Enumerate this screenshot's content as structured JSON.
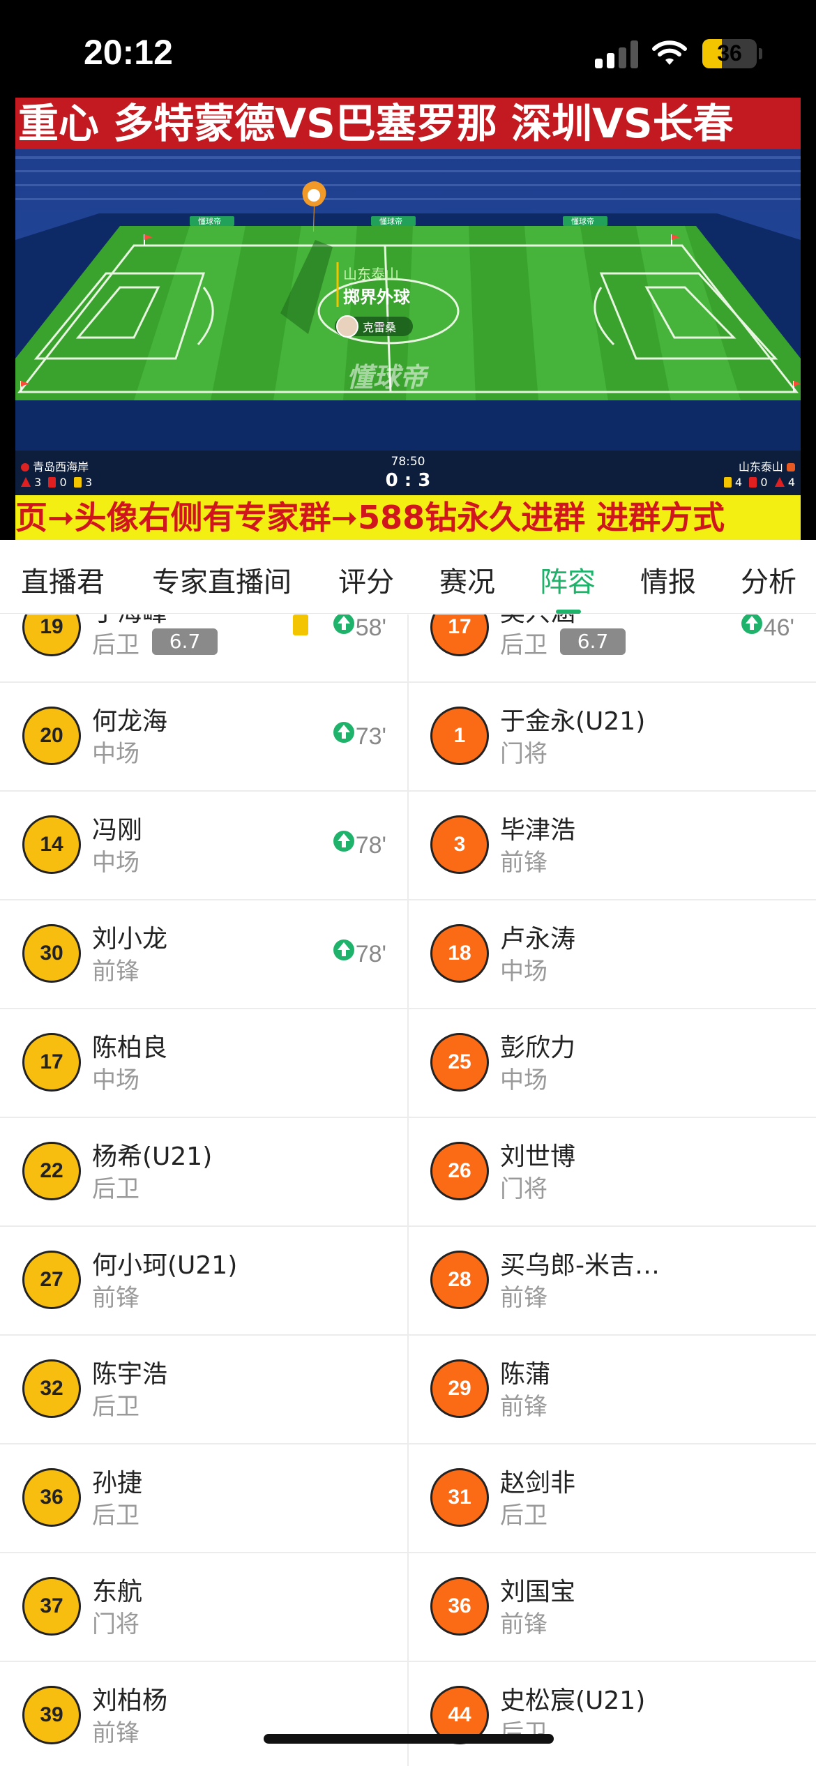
{
  "status_bar": {
    "time": "20:12",
    "battery": "36",
    "battery_level": 0.36
  },
  "video": {
    "ticker": "重心  多特蒙德VS巴塞罗那  深圳VS长春",
    "watermark": "懂球帝",
    "ad_board": "懂球帝",
    "event_team": "山东泰山",
    "event": "掷界外球",
    "event_player": "克雷桑",
    "home_team": "青岛西海岸",
    "away_team": "山东泰山",
    "clock": "78:50",
    "score_home": "0",
    "score_away": "3",
    "home_counts": {
      "corners": "3",
      "red": "0",
      "yellow": "3"
    },
    "away_counts": {
      "yellow": "4",
      "red": "0",
      "corners": "4"
    },
    "banner": "页➞头像右侧有专家群➞588钻永久进群    进群方式"
  },
  "tabs": [
    "直播君",
    "专家直播间",
    "评分",
    "赛况",
    "阵容",
    "情报",
    "分析"
  ],
  "active_tab": "阵容",
  "home_players": [
    {
      "number": "19",
      "name": "丁海峰",
      "position": "后卫",
      "rating": "6.7",
      "sub_minute": "58'",
      "yellow_card": true
    },
    {
      "number": "20",
      "name": "何龙海",
      "position": "中场",
      "sub_minute": "73'"
    },
    {
      "number": "14",
      "name": "冯刚",
      "position": "中场",
      "sub_minute": "78'"
    },
    {
      "number": "30",
      "name": "刘小龙",
      "position": "前锋",
      "sub_minute": "78'"
    },
    {
      "number": "17",
      "name": "陈柏良",
      "position": "中场"
    },
    {
      "number": "22",
      "name": "杨希(U21)",
      "position": "后卫"
    },
    {
      "number": "27",
      "name": "何小珂(U21)",
      "position": "前锋"
    },
    {
      "number": "32",
      "name": "陈宇浩",
      "position": "后卫"
    },
    {
      "number": "36",
      "name": "孙捷",
      "position": "后卫"
    },
    {
      "number": "37",
      "name": "东航",
      "position": "门将"
    },
    {
      "number": "39",
      "name": "刘柏杨",
      "position": "前锋"
    }
  ],
  "away_players": [
    {
      "number": "17",
      "name": "吴兴涵",
      "position": "后卫",
      "rating": "6.7",
      "sub_minute": "46'"
    },
    {
      "number": "1",
      "name": "于金永(U21)",
      "position": "门将"
    },
    {
      "number": "3",
      "name": "毕津浩",
      "position": "前锋"
    },
    {
      "number": "18",
      "name": "卢永涛",
      "position": "中场"
    },
    {
      "number": "25",
      "name": "彭欣力",
      "position": "中场"
    },
    {
      "number": "26",
      "name": "刘世博",
      "position": "门将"
    },
    {
      "number": "28",
      "name": "买乌郎-米吉…",
      "position": "前锋"
    },
    {
      "number": "29",
      "name": "陈蒲",
      "position": "前锋"
    },
    {
      "number": "31",
      "name": "赵剑非",
      "position": "后卫"
    },
    {
      "number": "36",
      "name": "刘国宝",
      "position": "前锋"
    },
    {
      "number": "44",
      "name": "史松宸(U21)",
      "position": "后卫"
    }
  ],
  "colors": {
    "accent": "#1fb26a",
    "home_badge": "#f8be0f",
    "away_badge": "#fb6a15",
    "ticker_bg": "#c21a20",
    "banner_bg": "#f4ef12"
  }
}
